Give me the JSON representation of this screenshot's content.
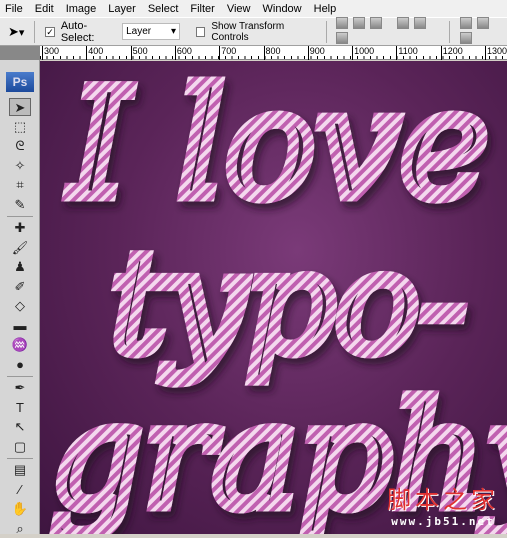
{
  "menu": [
    "File",
    "Edit",
    "Image",
    "Layer",
    "Select",
    "Filter",
    "View",
    "Window",
    "Help"
  ],
  "options": {
    "auto_select_label": "Auto-Select:",
    "auto_select_checked": true,
    "layer_select": "Layer",
    "show_transform_label": "Show Transform Controls",
    "show_transform_checked": false
  },
  "ruler": [
    "300",
    "400",
    "500",
    "600",
    "700",
    "800",
    "900",
    "1000",
    "1100",
    "1200",
    "1300"
  ],
  "toolbox": {
    "logo": "Ps",
    "tools": [
      {
        "name": "move-tool",
        "glyph": "➤"
      },
      {
        "name": "marquee-tool",
        "glyph": "⬚"
      },
      {
        "name": "lasso-tool",
        "glyph": "ᘓ"
      },
      {
        "name": "magic-wand-tool",
        "glyph": "✧"
      },
      {
        "name": "crop-tool",
        "glyph": "⌗"
      },
      {
        "name": "slice-tool",
        "glyph": "✎"
      },
      {
        "name": "healing-brush-tool",
        "glyph": "✚"
      },
      {
        "name": "brush-tool",
        "glyph": "🖌"
      },
      {
        "name": "clone-stamp-tool",
        "glyph": "♟"
      },
      {
        "name": "history-brush-tool",
        "glyph": "✐"
      },
      {
        "name": "eraser-tool",
        "glyph": "◇"
      },
      {
        "name": "gradient-tool",
        "glyph": "▬"
      },
      {
        "name": "blur-tool",
        "glyph": "♒"
      },
      {
        "name": "dodge-tool",
        "glyph": "●"
      },
      {
        "name": "pen-tool",
        "glyph": "✒"
      },
      {
        "name": "type-tool",
        "glyph": "T"
      },
      {
        "name": "path-selection-tool",
        "glyph": "↖"
      },
      {
        "name": "shape-tool",
        "glyph": "▢"
      },
      {
        "name": "notes-tool",
        "glyph": "▤"
      },
      {
        "name": "eyedropper-tool",
        "glyph": "⁄"
      },
      {
        "name": "hand-tool",
        "glyph": "✋"
      },
      {
        "name": "zoom-tool",
        "glyph": "⌕"
      }
    ]
  },
  "artwork": {
    "lines": [
      "I love",
      "typo-",
      "graphy"
    ],
    "colors": {
      "background": "#5a2458",
      "stripe_light": "#f4d8ee",
      "stripe_dark": "#c060b0"
    }
  },
  "watermark": {
    "cn": "脚本之家",
    "url": "www.jb51.net"
  }
}
